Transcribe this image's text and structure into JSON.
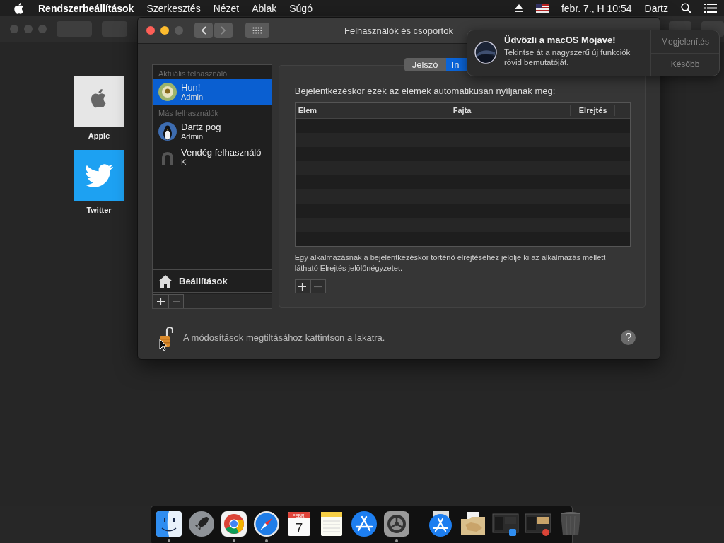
{
  "menubar": {
    "app": "Rendszerbeállítások",
    "menus": [
      "Szerkesztés",
      "Nézet",
      "Ablak",
      "Súgó"
    ],
    "clock": "febr. 7., H 10:54",
    "user": "Dartz"
  },
  "desktop_icons": [
    {
      "label": "Apple",
      "kind": "apple"
    },
    {
      "label": "Twitter",
      "kind": "twitter"
    }
  ],
  "window": {
    "title": "Felhasználók és csoportok"
  },
  "sidebar": {
    "sections": [
      {
        "heading": "Aktuális felhasználó",
        "users": [
          {
            "name": "Hun!",
            "role": "Admin",
            "selected": true,
            "kind": "flower"
          }
        ]
      },
      {
        "heading": "Más felhasználók",
        "users": [
          {
            "name": "Dartz pog",
            "role": "Admin",
            "selected": false,
            "kind": "penguin"
          },
          {
            "name": "Vendég felhasználó",
            "role": "Ki",
            "selected": false,
            "kind": "guest"
          }
        ]
      }
    ],
    "options": "Beállítások"
  },
  "tabs": [
    {
      "label": "Jelszó",
      "selected": false
    },
    {
      "label": "In",
      "selected": true
    }
  ],
  "login_items": {
    "heading": "Bejelentkezéskor ezek az elemek automatikusan nyíljanak meg:",
    "columns": [
      "Elem",
      "Fajta",
      "Elrejtés"
    ],
    "note": "Egy alkalmazásnak a bejelentkezéskor történő elrejtéséhez jelölje ki az alkalmazás mellett látható Elrejtés jelölőnégyzetet."
  },
  "lock": {
    "text": "A módosítások megtiltásához kattintson a lakatra."
  },
  "notification": {
    "title": "Üdvözli a macOS Mojave!",
    "body": "Tekintse át a nagyszerű új funkciók rövid bemutatóját.",
    "actions": [
      "Megjelenítés",
      "Később"
    ]
  },
  "dock": {
    "apps": [
      {
        "kind": "finder",
        "running": true
      },
      {
        "kind": "launchpad",
        "running": false
      },
      {
        "kind": "chrome",
        "running": true
      },
      {
        "kind": "safari",
        "running": true
      },
      {
        "kind": "calendar",
        "running": false,
        "month": "FEBR.",
        "day": "7"
      },
      {
        "kind": "notes",
        "running": false
      },
      {
        "kind": "appstore",
        "running": false
      },
      {
        "kind": "settings",
        "running": true
      }
    ],
    "others": [
      {
        "kind": "appstore"
      },
      {
        "kind": "folder"
      },
      {
        "kind": "screenshot",
        "badge": {
          "kind": "finder"
        }
      },
      {
        "kind": "screenshot",
        "badge": {
          "kind": "chrome"
        }
      },
      {
        "kind": "trash"
      }
    ]
  }
}
